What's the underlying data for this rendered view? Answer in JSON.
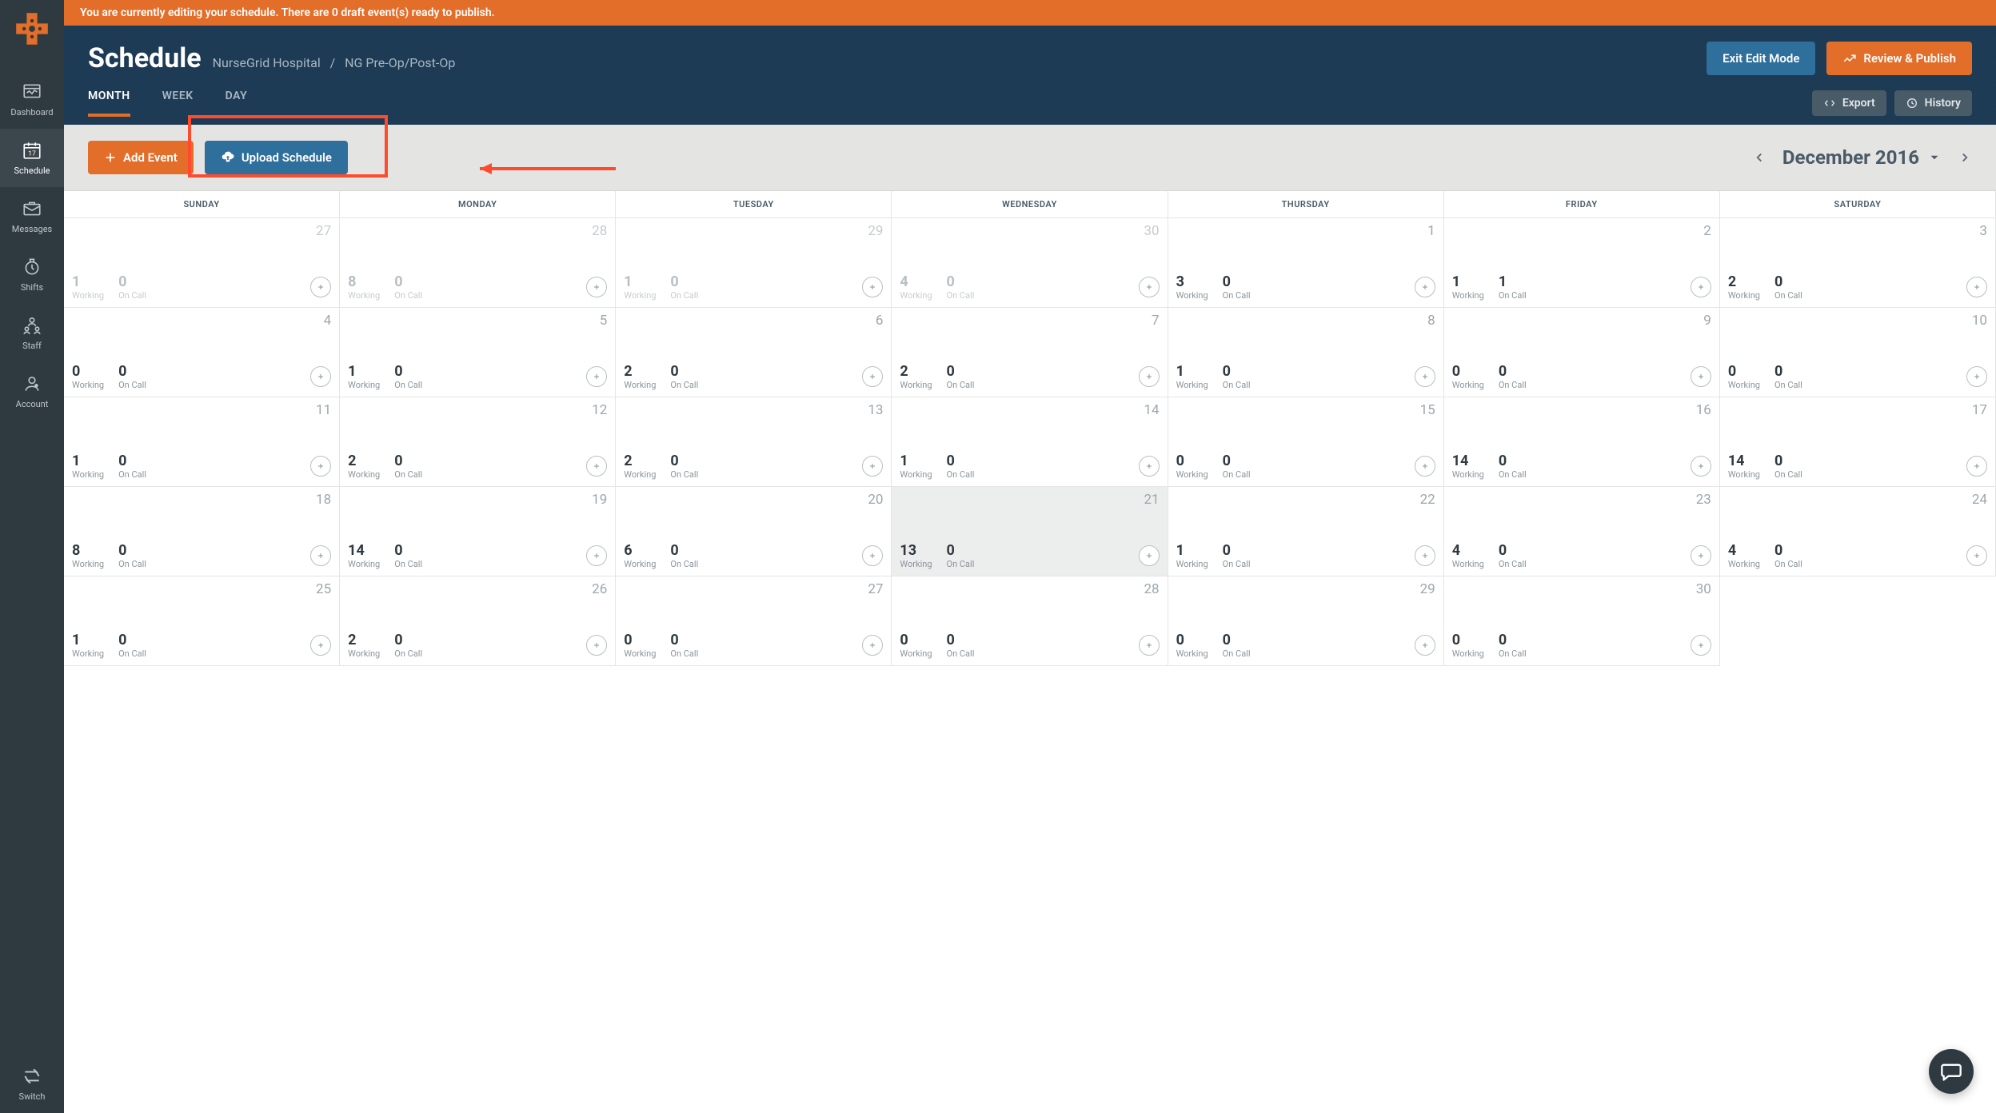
{
  "banner": "You are currently editing your schedule. There are 0 draft event(s) ready to publish.",
  "title": "Schedule",
  "breadcrumb": {
    "org": "NurseGrid Hospital",
    "unit": "NG Pre-Op/Post-Op",
    "sep": "/"
  },
  "header_buttons": {
    "exit": "Exit Edit Mode",
    "review": "Review & Publish"
  },
  "tabs": {
    "month": "MONTH",
    "week": "WEEK",
    "day": "DAY"
  },
  "header_actions": {
    "export": "Export",
    "history": "History"
  },
  "toolbar": {
    "add_event": "Add Event",
    "upload": "Upload Schedule"
  },
  "month_label": "December 2016",
  "sidebar": {
    "items": [
      {
        "label": "Dashboard"
      },
      {
        "label": "Schedule"
      },
      {
        "label": "Messages"
      },
      {
        "label": "Shifts"
      },
      {
        "label": "Staff"
      },
      {
        "label": "Account"
      }
    ],
    "switch_label": "Switch"
  },
  "day_headers": [
    "SUNDAY",
    "MONDAY",
    "TUESDAY",
    "WEDNESDAY",
    "THURSDAY",
    "FRIDAY",
    "SATURDAY"
  ],
  "labels": {
    "working": "Working",
    "oncall": "On Call"
  },
  "cells": [
    {
      "date": 27,
      "out": true,
      "working": 1,
      "oncall": 0
    },
    {
      "date": 28,
      "out": true,
      "working": 8,
      "oncall": 0
    },
    {
      "date": 29,
      "out": true,
      "working": 1,
      "oncall": 0
    },
    {
      "date": 30,
      "out": true,
      "working": 4,
      "oncall": 0
    },
    {
      "date": 1,
      "working": 3,
      "oncall": 0
    },
    {
      "date": 2,
      "working": 1,
      "oncall": 1
    },
    {
      "date": 3,
      "working": 2,
      "oncall": 0
    },
    {
      "date": 4,
      "working": 0,
      "oncall": 0
    },
    {
      "date": 5,
      "working": 1,
      "oncall": 0
    },
    {
      "date": 6,
      "working": 2,
      "oncall": 0
    },
    {
      "date": 7,
      "working": 2,
      "oncall": 0
    },
    {
      "date": 8,
      "working": 1,
      "oncall": 0
    },
    {
      "date": 9,
      "working": 0,
      "oncall": 0
    },
    {
      "date": 10,
      "working": 0,
      "oncall": 0
    },
    {
      "date": 11,
      "working": 1,
      "oncall": 0
    },
    {
      "date": 12,
      "working": 2,
      "oncall": 0
    },
    {
      "date": 13,
      "working": 2,
      "oncall": 0
    },
    {
      "date": 14,
      "working": 1,
      "oncall": 0
    },
    {
      "date": 15,
      "working": 0,
      "oncall": 0
    },
    {
      "date": 16,
      "working": 14,
      "oncall": 0
    },
    {
      "date": 17,
      "working": 14,
      "oncall": 0
    },
    {
      "date": 18,
      "working": 8,
      "oncall": 0
    },
    {
      "date": 19,
      "working": 14,
      "oncall": 0
    },
    {
      "date": 20,
      "working": 6,
      "oncall": 0
    },
    {
      "date": 21,
      "today": true,
      "working": 13,
      "oncall": 0
    },
    {
      "date": 22,
      "working": 1,
      "oncall": 0
    },
    {
      "date": 23,
      "working": 4,
      "oncall": 0
    },
    {
      "date": 24,
      "working": 4,
      "oncall": 0
    },
    {
      "date": 25,
      "working": 1,
      "oncall": 0
    },
    {
      "date": 26,
      "working": 2,
      "oncall": 0
    },
    {
      "date": 27,
      "working": 0,
      "oncall": 0
    },
    {
      "date": 28,
      "working": 0,
      "oncall": 0
    },
    {
      "date": 29,
      "working": 0,
      "oncall": 0
    },
    {
      "date": 30,
      "working": 0,
      "oncall": 0
    }
  ]
}
